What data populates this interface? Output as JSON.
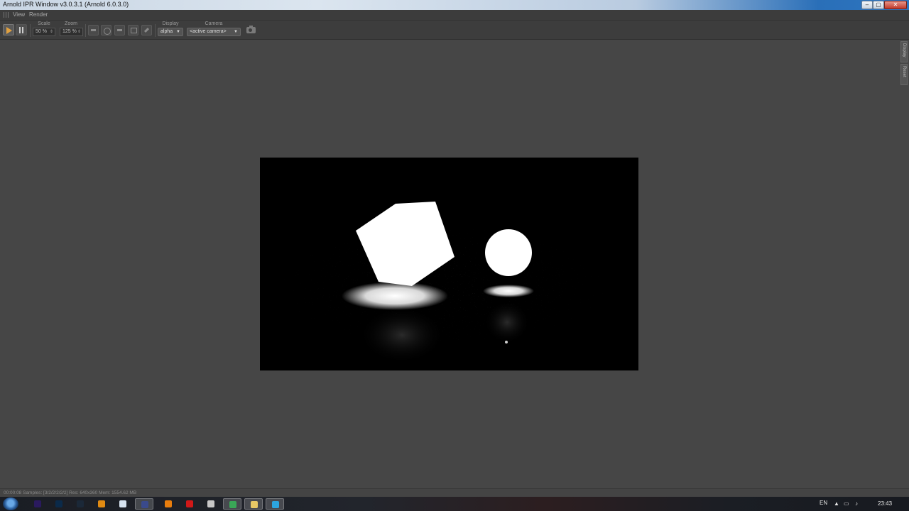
{
  "window": {
    "title": "Arnold IPR Window v3.0.3.1 (Arnold 6.0.3.0)",
    "controls": [
      "minimize-icon",
      "maximize-icon",
      "close-icon"
    ]
  },
  "menu": {
    "items": [
      "View",
      "Render"
    ]
  },
  "toolbar": {
    "play_icon": "play-icon",
    "pause_icon": "pause-icon",
    "scale": {
      "label": "Scale",
      "value": "50 %"
    },
    "zoom": {
      "label": "Zoom",
      "value": "125 %"
    },
    "tool_icons": [
      "region-icon",
      "crosshair-icon",
      "isolate-icon",
      "crop-icon",
      "brush-icon"
    ],
    "display": {
      "label": "Display",
      "value": "alpha"
    },
    "camera": {
      "label": "Camera",
      "value": "<active camera>"
    },
    "snapshot_icon": "camera-icon"
  },
  "side_tabs": [
    "Display",
    "Reset"
  ],
  "render": {
    "description_icon": "render-viewport",
    "background_color": "#000000",
    "object_color": "#ffffff"
  },
  "status": {
    "text": "00:00:08  Samples: [3/2/2/2/2/2]  Res: 640x360  Mem: 1554.62 MB"
  },
  "taskbar": {
    "apps": [
      {
        "icon": "after-effects-icon",
        "color": "#2a1a5e"
      },
      {
        "icon": "photoshop-icon",
        "color": "#0b2a4a"
      },
      {
        "icon": "steam-icon",
        "color": "#1b2838"
      },
      {
        "icon": "avast-icon",
        "color": "#e08a12"
      },
      {
        "icon": "notepad-icon",
        "color": "#d6e3f0"
      },
      {
        "icon": "cinema4d-icon",
        "color": "#3a4a8c"
      },
      {
        "icon": "blender-icon",
        "color": "#e87d0d"
      },
      {
        "icon": "opera-icon",
        "color": "#d01818"
      },
      {
        "icon": "vpn-icon",
        "color": "#c8c8c8"
      },
      {
        "icon": "chrome-icon",
        "color": "#3aa757"
      },
      {
        "icon": "explorer-icon",
        "color": "#e8c865"
      },
      {
        "icon": "telegram-icon",
        "color": "#2ca5e0"
      }
    ],
    "lang": "EN",
    "clock": "23:43"
  }
}
